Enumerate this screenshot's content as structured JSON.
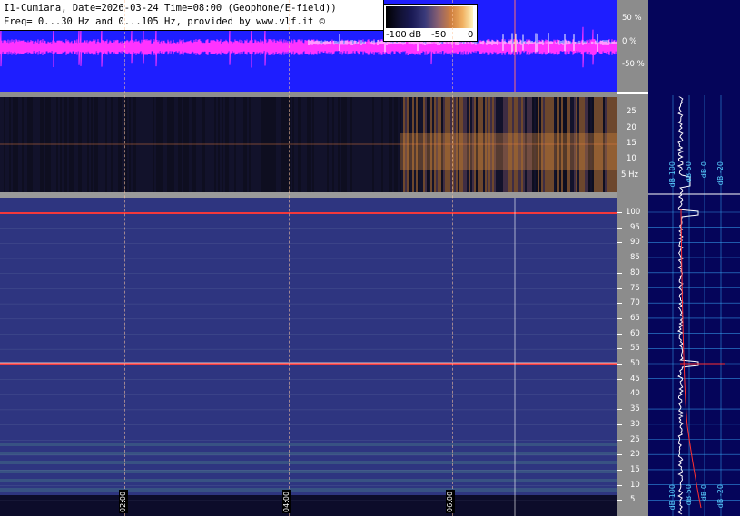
{
  "title": {
    "line1": "I1-Cumiana, Date=2026-03-24 Time=08:00 (Geophone/E-field))",
    "line2": "Freq= 0...30 Hz and 0...105 Hz, provided by www.vlf.it ©"
  },
  "colorbar": {
    "labels": [
      "-100 dB",
      "-50",
      "0"
    ]
  },
  "waveform_axis": [
    "50 %",
    "0 %",
    "-50 %"
  ],
  "low_axis": [
    "25",
    "20",
    "15",
    "10",
    "5 Hz"
  ],
  "high_axis": [
    "100",
    "95",
    "90",
    "85",
    "80",
    "75",
    "70",
    "65",
    "60",
    "55",
    "50",
    "45",
    "40",
    "35",
    "30",
    "25",
    "20",
    "15",
    "10",
    "5"
  ],
  "time_labels": [
    "02:00",
    "04:00",
    "06:00"
  ],
  "profile_labels_top": [
    "dB 100",
    "dB 50",
    "dB 0",
    "dB -20"
  ],
  "profile_labels_bottom": [
    "dB 100",
    "dB 50",
    "dB 0",
    "dB -20"
  ],
  "colors": {
    "waveform_bg": "#1e1eff",
    "waveform_trace": "#ff33ff",
    "spectrum_bg": "#2e3580",
    "line_50hz": "#ff3030",
    "profile_bg": "#05055a",
    "grid": "#3ab0ff"
  }
}
